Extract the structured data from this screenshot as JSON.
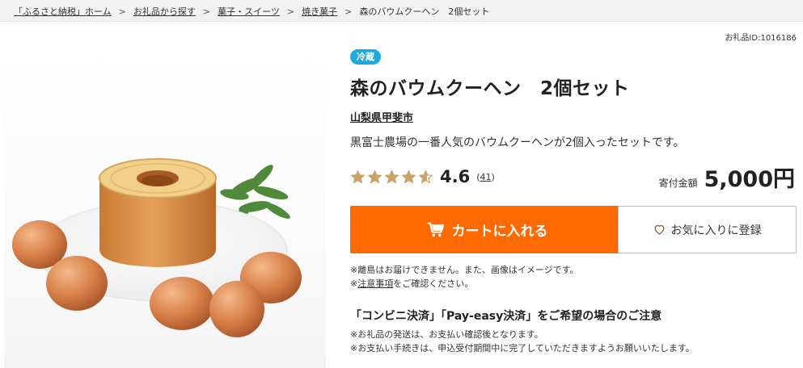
{
  "breadcrumb": {
    "items": [
      "「ふるさと納税」ホーム",
      "お礼品から探す",
      "菓子・スイーツ",
      "焼き菓子"
    ],
    "separator": ">",
    "current": "森のバウムクーヘン　2個セット"
  },
  "item_id": "お礼品ID:1016186",
  "badge": "冷蔵",
  "title": "森のバウムクーヘン　2個セット",
  "municipality": "山梨県甲斐市",
  "description": "黒富士農場の一番人気のバウムクーヘンが2個入ったセットです。",
  "rating": {
    "value": "4.6",
    "count_open": "(",
    "count": "41",
    "count_close": ")",
    "stars_fraction": 0.92
  },
  "price": {
    "label": "寄付金額",
    "value": "5,000円"
  },
  "cart_button": {
    "label": "カートに入れる",
    "icon": "cart-icon"
  },
  "favorite_button": {
    "label": "お気に入りに登録",
    "icon": "heart-icon"
  },
  "notes": {
    "line1": "※離島はお届けできません。また、画像はイメージです。",
    "line2_prefix": "※",
    "line2_link": "注意事項",
    "line2_suffix": "をご確認ください。"
  },
  "payment": {
    "heading": "「コンビニ決済」「Pay-easy決済」をご希望の場合のご注意",
    "line1": "※お礼品の発送は、お支払い確認後となります。",
    "line2": "※お支払い手続きは、申込受付期間中に完了していただきますようお願いいたします。"
  },
  "colors": {
    "accent": "#ff6a00",
    "badge": "#1eaade",
    "star": "#c9a36a"
  }
}
